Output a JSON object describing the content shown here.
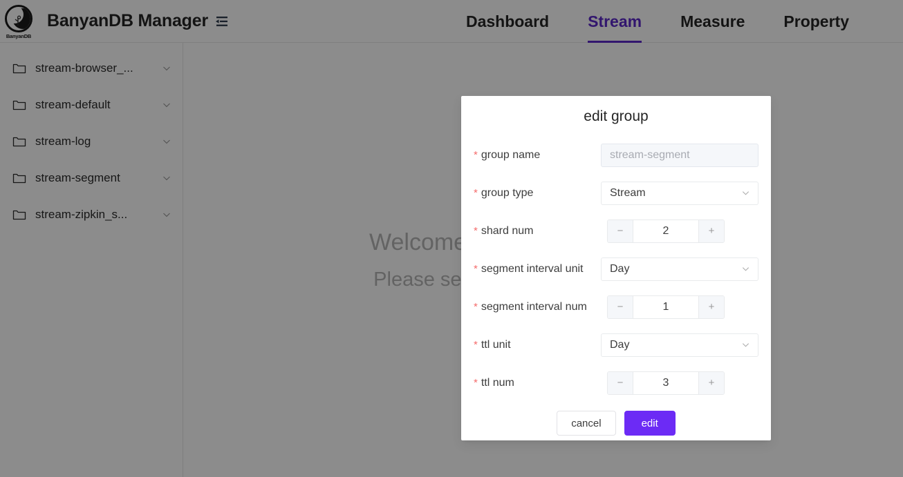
{
  "header": {
    "logo_text": "BanyanDB",
    "logo_icon": "banyandb-moon-logo",
    "title": "BanyanDB Manager",
    "fold_icon": "menu-fold-icon",
    "nav": [
      {
        "label": "Dashboard",
        "active": false
      },
      {
        "label": "Stream",
        "active": true
      },
      {
        "label": "Measure",
        "active": false
      },
      {
        "label": "Property",
        "active": false
      }
    ],
    "active_color": "#5b28c9"
  },
  "sidebar": {
    "items": [
      {
        "label": "stream-browser_...",
        "icon": "folder-icon",
        "chevron": "chevron-down-icon"
      },
      {
        "label": "stream-default",
        "icon": "folder-icon",
        "chevron": "chevron-down-icon"
      },
      {
        "label": "stream-log",
        "icon": "folder-icon",
        "chevron": "chevron-down-icon"
      },
      {
        "label": "stream-segment",
        "icon": "folder-icon",
        "chevron": "chevron-down-icon"
      },
      {
        "label": "stream-zipkin_s...",
        "icon": "folder-icon",
        "chevron": "chevron-down-icon"
      }
    ]
  },
  "main": {
    "welcome_line1": "Welcome to BanyanDB Manager!",
    "welcome_line2": "Please select a group to start working!"
  },
  "modal": {
    "title": "edit group",
    "required_mark": "*",
    "fields": {
      "group_name": {
        "label": "group name",
        "value": "stream-segment",
        "placeholder": "stream-segment",
        "disabled": true
      },
      "group_type": {
        "label": "group type",
        "value": "Stream",
        "chevron": "chevron-down-icon"
      },
      "shard_num": {
        "label": "shard num",
        "value": "2",
        "minus": "−",
        "plus": "+"
      },
      "segment_interval_unit": {
        "label": "segment interval unit",
        "value": "Day",
        "chevron": "chevron-down-icon"
      },
      "segment_interval_num": {
        "label": "segment interval num",
        "value": "1",
        "minus": "−",
        "plus": "+"
      },
      "ttl_unit": {
        "label": "ttl unit",
        "value": "Day",
        "chevron": "chevron-down-icon"
      },
      "ttl_num": {
        "label": "ttl num",
        "value": "3",
        "minus": "−",
        "plus": "+"
      }
    },
    "cancel_label": "cancel",
    "submit_label": "edit",
    "submit_color": "#6c2bf5"
  }
}
